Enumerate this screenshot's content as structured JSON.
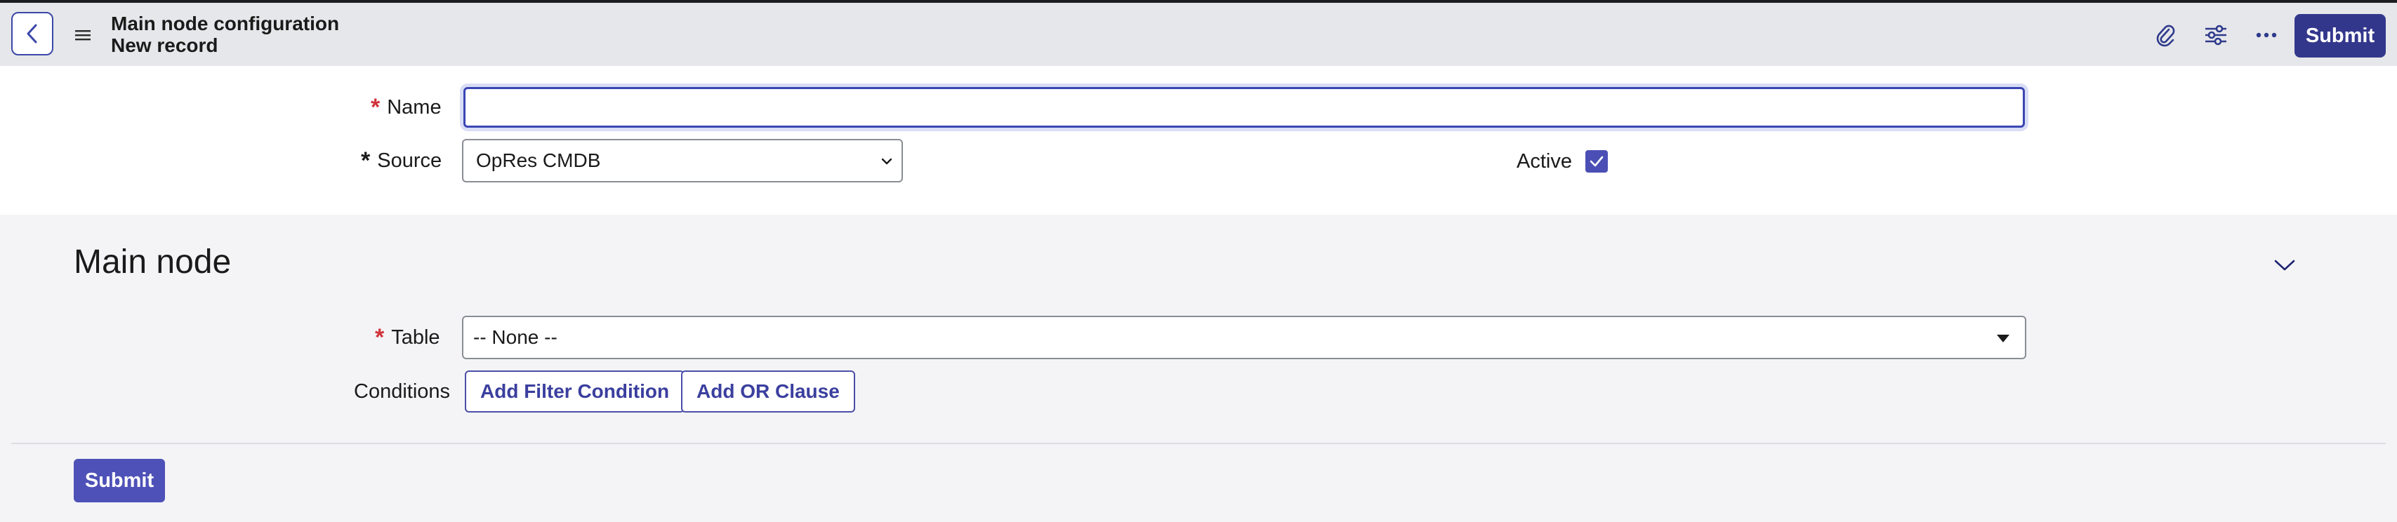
{
  "header": {
    "title": "Main node configuration",
    "subtitle": "New record",
    "submit_label": "Submit",
    "icons": [
      "chevron-left-icon",
      "hamburger-menu-icon",
      "paperclip-icon",
      "sliders-icon",
      "more-horizontal-icon"
    ]
  },
  "form": {
    "name_label": "Name",
    "name_value": "",
    "source_label": "Source",
    "source_value": "OpRes CMDB",
    "active_label": "Active",
    "active_checked": true
  },
  "main_node": {
    "section_title": "Main node",
    "table_label": "Table",
    "table_value": "-- None --",
    "conditions_label": "Conditions",
    "add_filter_label": "Add Filter Condition",
    "add_or_label": "Add OR Clause",
    "submit_label": "Submit"
  },
  "colors": {
    "primary": "#33378c",
    "accent": "#4e51b7",
    "required": "#d0343a",
    "header_bg": "#e6e7ea",
    "section_bg": "#f4f4f6"
  }
}
